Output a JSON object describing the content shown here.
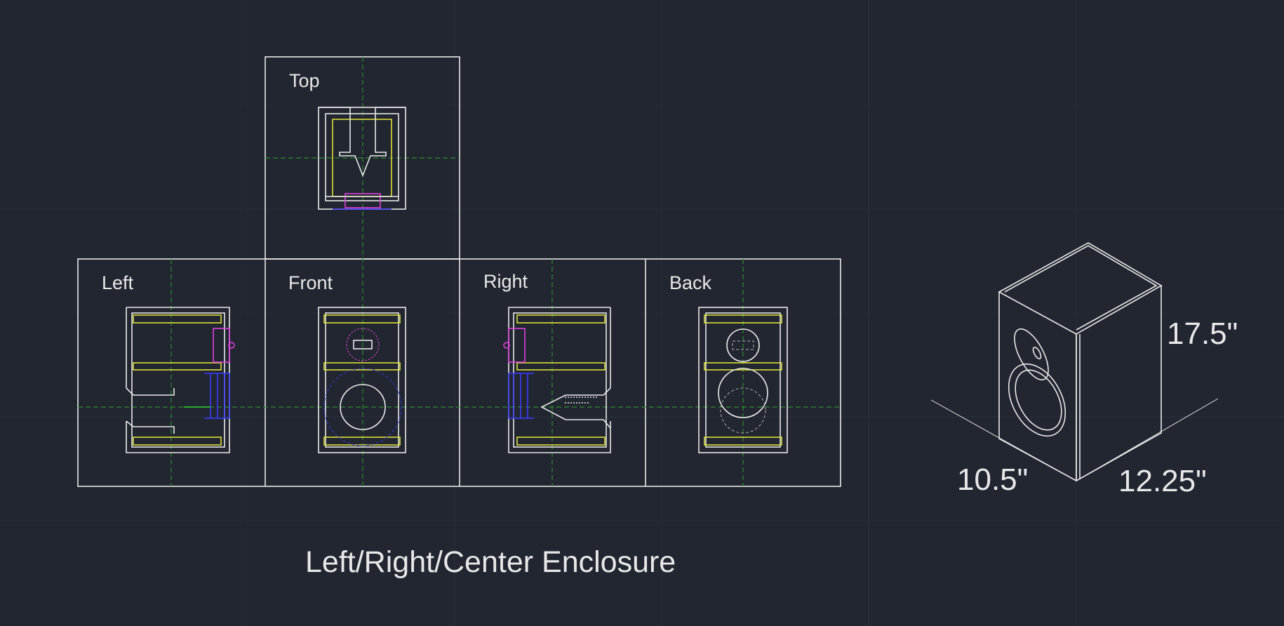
{
  "views": {
    "top": "Top",
    "left": "Left",
    "front": "Front",
    "right": "Right",
    "back": "Back"
  },
  "dimensions": {
    "height": "17.5\"",
    "width": "10.5\"",
    "depth": "12.25\""
  },
  "drawing_title": "Left/Right/Center Enclosure",
  "colors": {
    "background": "#212630",
    "outline": "#e9e9e9",
    "panel": "#dede39",
    "tweeter": "#e040e0",
    "woofer": "#3b3bff",
    "centerline": "#2f8a2f"
  }
}
